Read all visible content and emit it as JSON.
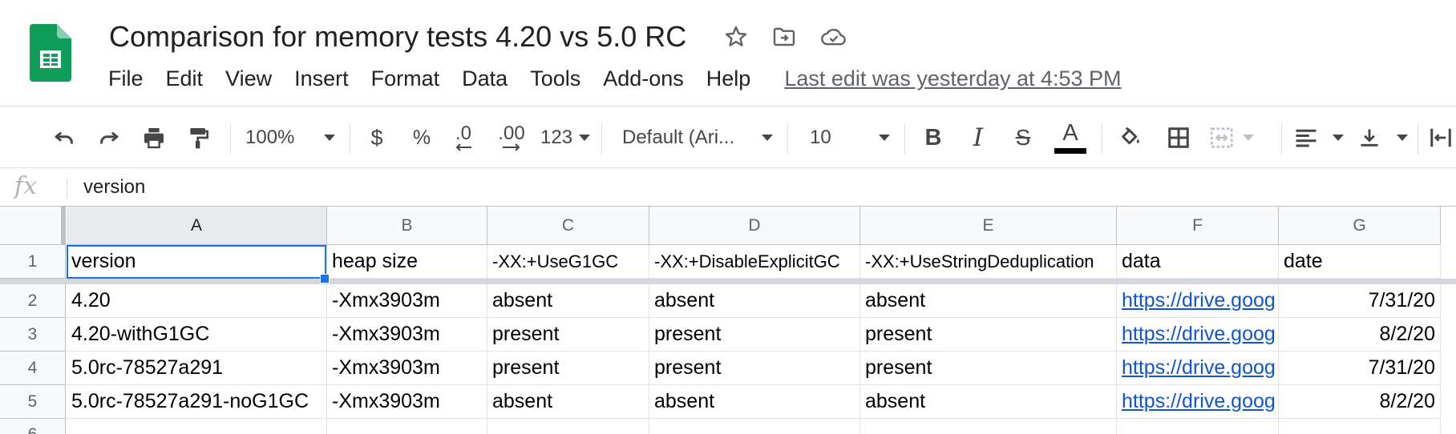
{
  "app": {
    "logo_icon": "google-sheets-logo-icon",
    "brand_color": "#0f9d58",
    "title": "Comparison for memory tests 4.20 vs 5.0 RC",
    "title_icons": [
      "star-icon",
      "move-to-folder-icon",
      "cloud-saved-icon"
    ]
  },
  "menu": {
    "items": [
      "File",
      "Edit",
      "View",
      "Insert",
      "Format",
      "Data",
      "Tools",
      "Add-ons",
      "Help"
    ],
    "last_edit": "Last edit was yesterday at 4:53 PM"
  },
  "toolbar": {
    "zoom": "100%",
    "currency": "$",
    "percent": "%",
    "decrease_decimal": ".0",
    "increase_decimal": ".00",
    "more_formats": "123",
    "font": "Default (Ari...",
    "font_size": "10",
    "bold": "B",
    "italic": "I",
    "strike": "S",
    "text_color": "A",
    "icons": [
      "undo-icon",
      "redo-icon",
      "print-icon",
      "paint-format-icon",
      "fill-color-icon",
      "borders-icon",
      "merge-cells-icon",
      "horizontal-align-icon",
      "vertical-align-icon",
      "text-wrapping-icon"
    ]
  },
  "formula_bar": {
    "fx": "fx",
    "content": "version"
  },
  "sheet": {
    "columns": [
      "A",
      "B",
      "C",
      "D",
      "E",
      "F",
      "G"
    ],
    "rows": [
      "1",
      "2",
      "3",
      "4",
      "5",
      "6"
    ],
    "header_row": [
      "version",
      "heap size",
      "-XX:+UseG1GC",
      "-XX:+DisableExplicitGC",
      "-XX:+UseStringDeduplication",
      "data",
      "date"
    ],
    "data_rows": [
      [
        "4.20",
        "-Xmx3903m",
        "absent",
        "absent",
        "absent",
        "https://drive.goog",
        "7/31/20"
      ],
      [
        "4.20-withG1GC",
        "-Xmx3903m",
        "present",
        "present",
        "present",
        "https://drive.goog",
        "8/2/20"
      ],
      [
        "5.0rc-78527a291",
        "-Xmx3903m",
        "present",
        "present",
        "present",
        "https://drive.goog",
        "7/31/20"
      ],
      [
        "5.0rc-78527a291-noG1GC",
        "-Xmx3903m",
        "absent",
        "absent",
        "absent",
        "https://drive.goog",
        "8/2/20"
      ]
    ],
    "selection_color": "#1a73e8",
    "link_color": "#1155cc"
  }
}
